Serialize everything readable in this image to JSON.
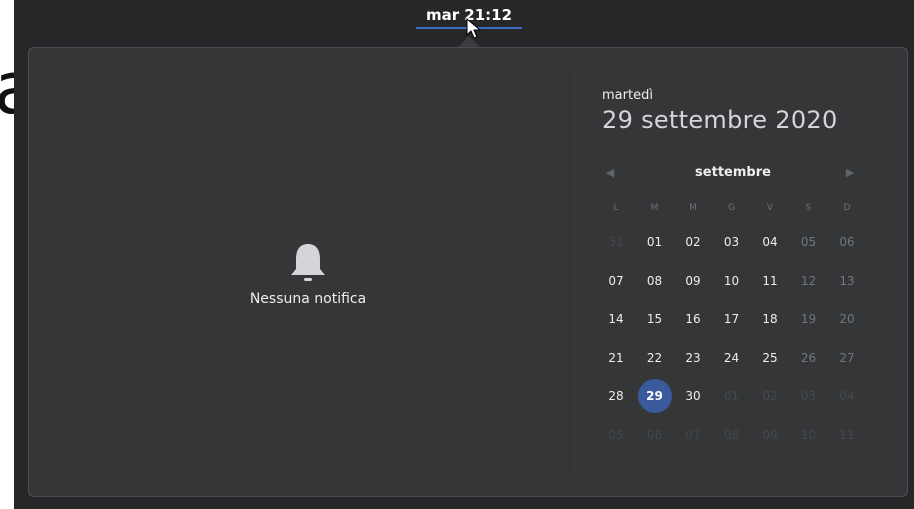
{
  "topbar": {
    "clock": "mar 21:12",
    "accent_color": "#3d6bbf"
  },
  "notifications": {
    "empty_icon": "bell-icon",
    "empty_label": "Nessuna notifica"
  },
  "calendar": {
    "weekday": "martedì",
    "date_full": "29 settembre 2020",
    "month": "settembre",
    "prev_icon": "triangle-left-icon",
    "next_icon": "triangle-right-icon",
    "day_headers": [
      "L",
      "M",
      "M",
      "G",
      "V",
      "S",
      "D"
    ],
    "today": "29",
    "today_color": "#3a5a9c",
    "weeks": [
      [
        "31",
        "01",
        "02",
        "03",
        "04",
        "05",
        "06"
      ],
      [
        "07",
        "08",
        "09",
        "10",
        "11",
        "12",
        "13"
      ],
      [
        "14",
        "15",
        "16",
        "17",
        "18",
        "19",
        "20"
      ],
      [
        "21",
        "22",
        "23",
        "24",
        "25",
        "26",
        "27"
      ],
      [
        "28",
        "29",
        "30",
        "01",
        "02",
        "03",
        "04"
      ],
      [
        "05",
        "06",
        "07",
        "08",
        "09",
        "10",
        "11"
      ]
    ]
  }
}
